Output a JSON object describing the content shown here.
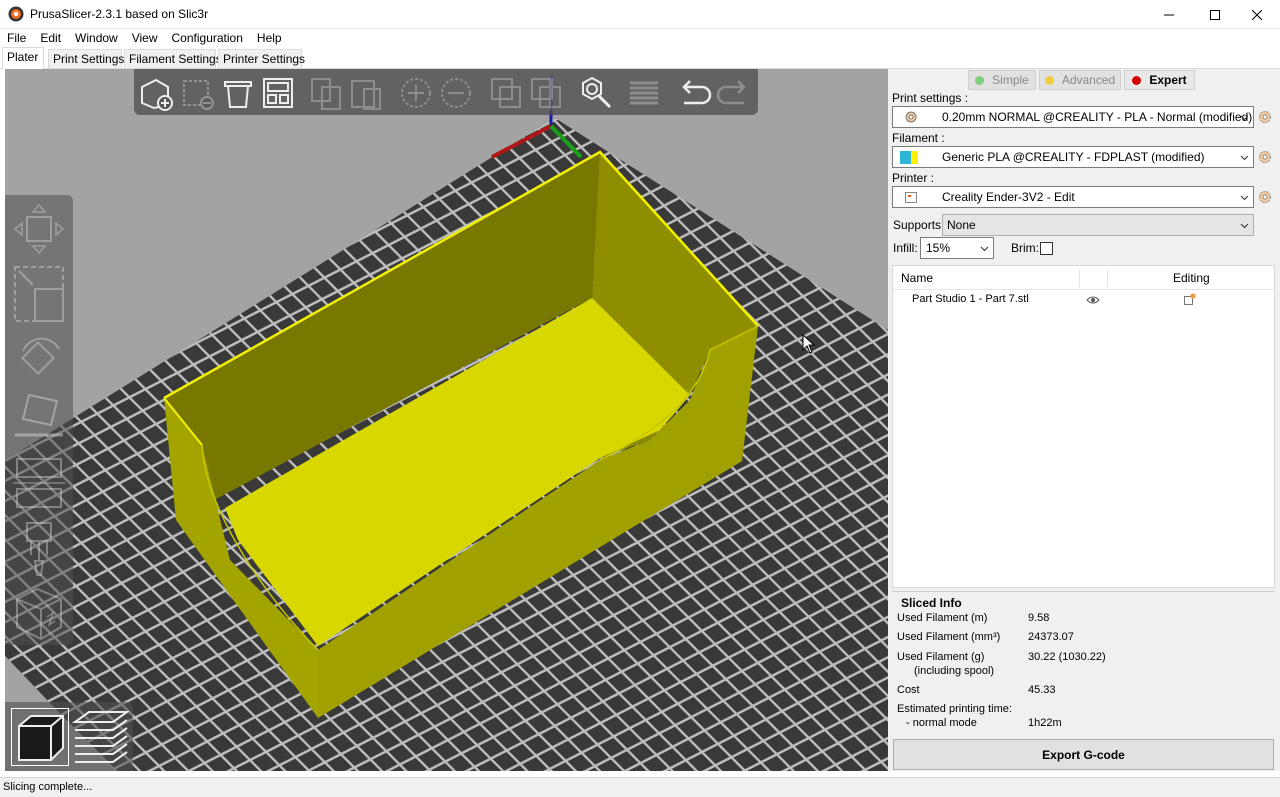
{
  "window": {
    "title": "PrusaSlicer-2.3.1 based on Slic3r"
  },
  "menu": [
    "File",
    "Edit",
    "Window",
    "View",
    "Configuration",
    "Help"
  ],
  "tabs": [
    "Plater",
    "Print Settings",
    "Filament Settings",
    "Printer Settings"
  ],
  "active_tab": "Plater",
  "modes": {
    "simple": "Simple",
    "advanced": "Advanced",
    "expert": "Expert",
    "active": "Expert",
    "colors": {
      "simple": "#3ec13e",
      "advanced": "#f5c400",
      "expert": "#d40000"
    }
  },
  "print_settings": {
    "label": "Print settings :",
    "value": "0.20mm NORMAL @CREALITY - PLA - Normal (modified)"
  },
  "filament": {
    "label": "Filament :",
    "value": "Generic PLA @CREALITY - FDPLAST (modified)",
    "colors": [
      "#2fb6d6",
      "#ffef00"
    ]
  },
  "printer": {
    "label": "Printer :",
    "value": "Creality Ender-3V2 - Edit"
  },
  "supports": {
    "label": "Supports:",
    "value": "None"
  },
  "infill": {
    "label": "Infill:",
    "value": "15%"
  },
  "brim": {
    "label": "Brim:",
    "checked": false
  },
  "object_list": {
    "col_name": "Name",
    "col_editing": "Editing",
    "items": [
      {
        "name": "Part Studio 1 - Part 7.stl",
        "visible_icon": "eye-icon",
        "edit_icon": "edit-object-icon"
      }
    ]
  },
  "sliced_info": {
    "title": "Sliced Info",
    "rows": [
      {
        "label": "Used Filament (m)",
        "value": "9.58"
      },
      {
        "label": "Used Filament (mm³)",
        "value": "24373.07"
      },
      {
        "label": "Used Filament (g)",
        "sublabel": "(including spool)",
        "value": "30.22 (1030.22)"
      },
      {
        "label": "Cost",
        "value": "45.33"
      },
      {
        "label": "Estimated printing time:",
        "sublabel": "- normal mode",
        "value": "1h22m"
      }
    ]
  },
  "export_button": "Export G-code",
  "status": "Slicing complete...",
  "toolbar_icons": [
    "add-icon",
    "delete-icon",
    "delete-all-icon",
    "arrange-icon",
    "copy-icon",
    "paste-icon",
    "add-instance-icon",
    "remove-instance-icon",
    "split-objects-icon",
    "split-parts-icon",
    "search-icon",
    "layers-editing-icon",
    "undo-icon",
    "redo-icon"
  ],
  "gizmo_icons": [
    "move-icon",
    "scale-icon",
    "rotate-icon",
    "place-on-face-icon",
    "cut-icon",
    "supports-paint-icon",
    "seam-paint-icon"
  ],
  "view_icons": [
    "3d-view-icon",
    "preview-icon"
  ],
  "model_color": "#dddd00"
}
